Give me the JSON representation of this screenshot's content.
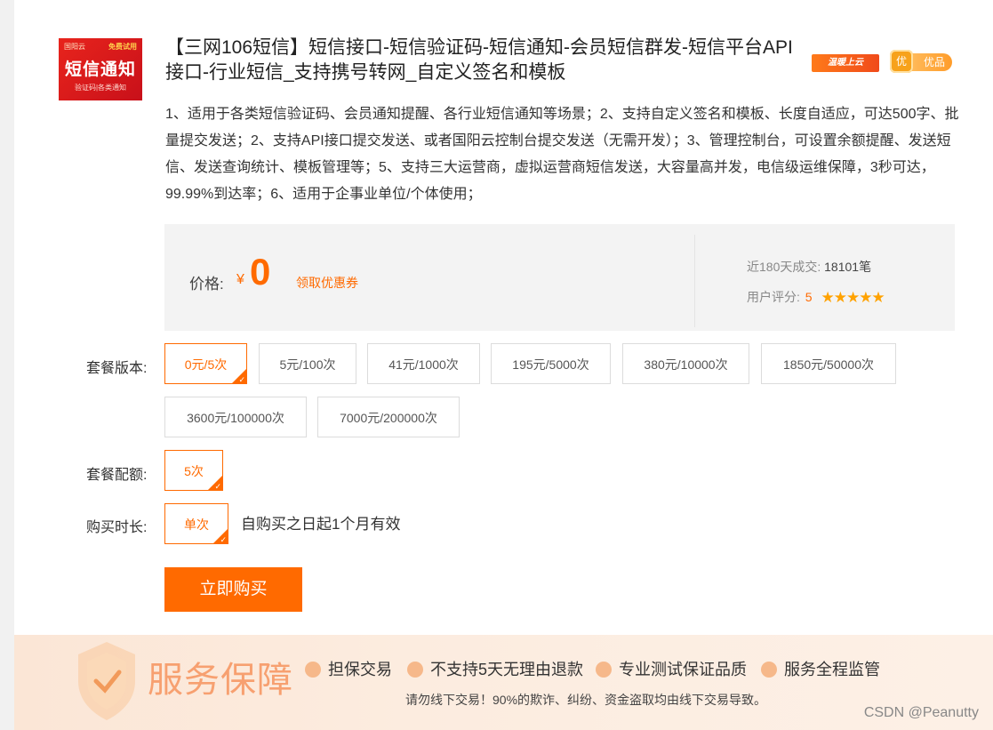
{
  "product": {
    "thumb_brand": "国阳云",
    "thumb_trial": "免费试用",
    "thumb_big": "短信通知",
    "thumb_sub": "验证码|各类通知",
    "title": "【三网106短信】短信接口-短信验证码-短信通知-会员短信群发-短信平台API接口-行业短信_支持携号转网_自定义签名和模板",
    "badge_cloud": "温暖上云",
    "badge_quality_icon": "优",
    "badge_quality": "优品",
    "description": "1、适用于各类短信验证码、会员通知提醒、各行业短信通知等场景；2、支持自定义签名和模板、长度自适应，可达500字、批量提交发送；2、支持API接口提交发送、或者国阳云控制台提交发送（无需开发）；3、管理控制台，可设置余额提醒、发送短信、发送查询统计、模板管理等；5、支持三大运营商，虚拟运营商短信发送，大容量高并发，电信级运维保障，3秒可达，99.99%到达率；6、适用于企事业单位/个体使用；"
  },
  "price": {
    "label": "价格:",
    "currency": "¥",
    "value": "0",
    "coupon_link": "领取优惠券",
    "sales_label": "近180天成交:",
    "sales_value": "18101笔",
    "rating_label": "用户评分:",
    "rating_value": "5",
    "stars": "★★★★★"
  },
  "options": {
    "version_label": "套餐版本:",
    "versions": [
      "0元/5次",
      "5元/100次",
      "41元/1000次",
      "195元/5000次",
      "380元/10000次",
      "1850元/50000次",
      "3600元/100000次",
      "7000元/200000次"
    ],
    "selected_version": "0元/5次",
    "quota_label": "套餐配额:",
    "quota_value": "5次",
    "duration_label": "购买时长:",
    "duration_value": "单次",
    "validity_text": "自购买之日起1个月有效"
  },
  "buy_button": "立即购买",
  "service": {
    "title": "服务保障",
    "items": [
      "担保交易",
      "不支持5天无理由退款",
      "专业测试保证品质",
      "服务全程监管"
    ],
    "note": "请勿线下交易！90%的欺诈、纠纷、资金盗取均由线下交易导致。"
  },
  "watermark": "CSDN @Peanutty",
  "colors": {
    "accent": "#ff6a00",
    "star": "#ffa200"
  },
  "icons": [
    "check-icon",
    "star-icon",
    "shield-icon",
    "quality-badge-icon"
  ]
}
